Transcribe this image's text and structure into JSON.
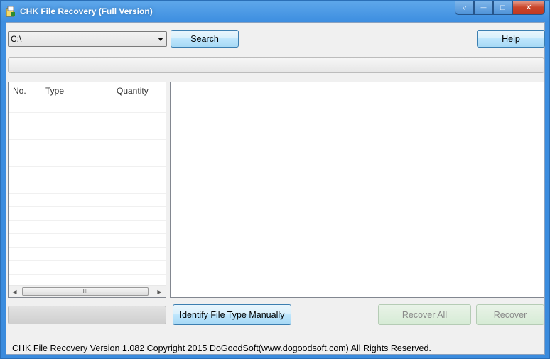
{
  "window": {
    "title": "CHK File Recovery (Full Version)",
    "caption_buttons": [
      {
        "name": "dropdown",
        "glyph": "▿"
      },
      {
        "name": "minimize",
        "glyph": "—"
      },
      {
        "name": "maximize",
        "glyph": "□"
      },
      {
        "name": "close",
        "glyph": "✕"
      }
    ]
  },
  "toolbar": {
    "drive_value": "C:\\",
    "search_label": "Search",
    "help_label": "Help"
  },
  "list": {
    "columns": [
      "No.",
      "Type",
      "Quantity"
    ],
    "rows": 13,
    "scroll_grip": "III"
  },
  "actions": {
    "identify_label": "Identify File Type Manually",
    "recover_all_label": "Recover All",
    "recover_label": "Recover"
  },
  "status": {
    "text": "CHK File Recovery Version 1.082  Copyright 2015 DoGoodSoft(www.dogoodsoft.com) All Rights Reserved."
  },
  "colors": {
    "titlebar": "#3d8ee0",
    "button_blue": "#bee6fd",
    "button_disabled": "#d6ebd5"
  }
}
